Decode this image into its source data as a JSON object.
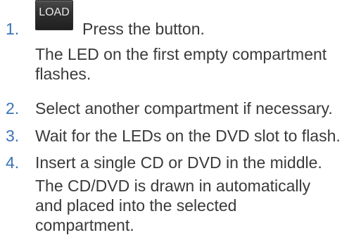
{
  "steps": [
    {
      "number": "1.",
      "button_label": "LOAD",
      "text": "Press the button.",
      "description": "The LED on the first empty compartment flashes."
    },
    {
      "number": "2.",
      "text": "Select another compartment if necessary."
    },
    {
      "number": "3.",
      "text": "Wait for the LEDs on the DVD slot to flash."
    },
    {
      "number": "4.",
      "text": "Insert a single CD or DVD in the middle.",
      "description": "The CD/DVD is drawn in automatically and placed into the selected compartment."
    }
  ],
  "colors": {
    "step_number": "#3a74b8",
    "text": "#3a3a3a",
    "button_bg": "#2f2f2f",
    "button_text": "#e8e8e8"
  }
}
